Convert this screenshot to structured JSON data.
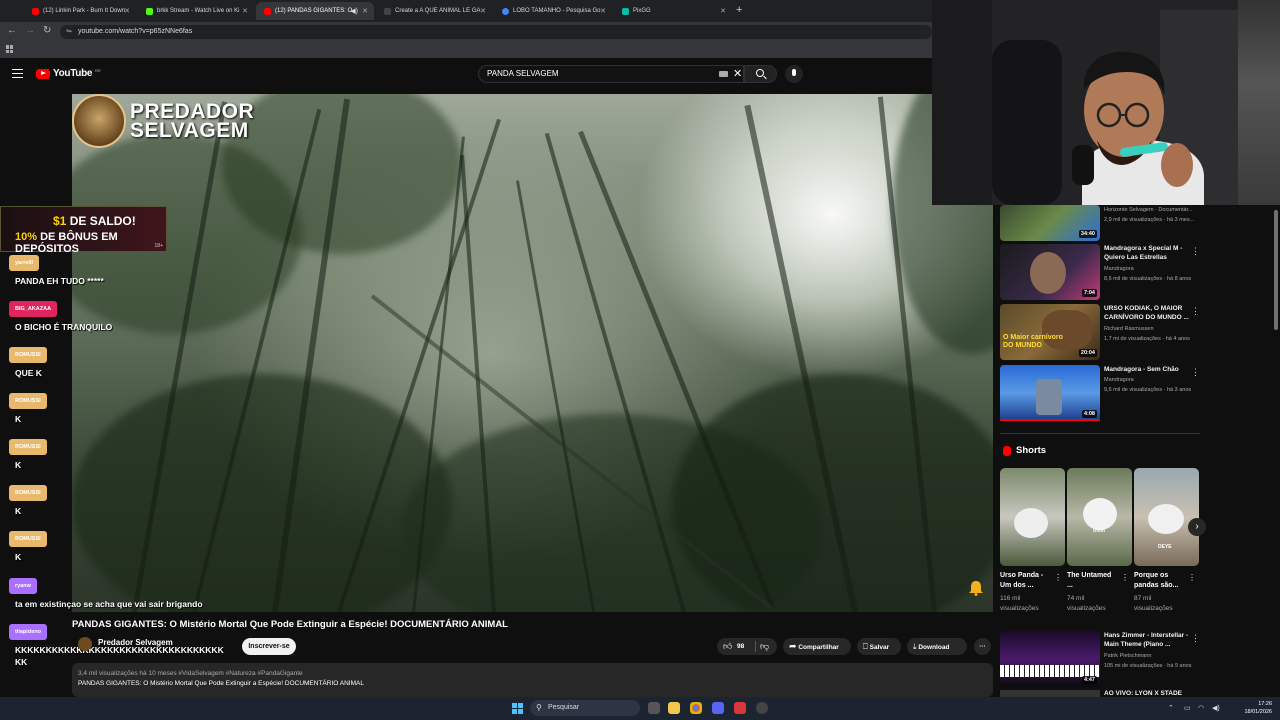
{
  "browser": {
    "tabs": [
      {
        "label": "(12) Linkin Park - Burn It Down",
        "color": "#ff0000"
      },
      {
        "label": "brkk Stream - Watch Live on Ki",
        "color": "#53fc18"
      },
      {
        "label": "(12) PANDAS GIGANTES: O",
        "color": "#ff0000",
        "active": true
      },
      {
        "label": "Create a A QUE ANIMAL LE GA",
        "color": "#444444"
      },
      {
        "label": "LOBO TAMANHO - Pesquisa Go",
        "color": "#4285f4"
      },
      {
        "label": "PixGG",
        "color": "#00bfa5"
      }
    ],
    "new_tab": "+",
    "url": "youtube.com/watch?v=p65zNNe6fas"
  },
  "youtube": {
    "logo_text": "YouTube",
    "logo_country": "BR",
    "search_value": "PANDA SELVAGEM"
  },
  "video": {
    "watermark_line1": "PREDADOR",
    "watermark_line2": "SELVAGEM",
    "title": "PANDAS GIGANTES: O Mistério Mortal Que Pode Extinguir a Espécie! DOCUMENTÁRIO ANIMAL",
    "channel": "Predador Selvagem",
    "subscribe": "Inscrever-se",
    "likes": "98",
    "share": "Compartilhar",
    "save": "Salvar",
    "download": "Download",
    "desc_meta": "3,4 mil visualizações  há 10 meses  #VidaSelvagem #Natureza #PandaGigante",
    "desc_text": "PANDAS GIGANTES: O Mistério Mortal Que Pode Extinguir a Espécie! DOCUMENTÁRIO ANIMAL"
  },
  "promo": {
    "amount": "$1",
    "line1_rest": " DE SALDO!",
    "percent": "10%",
    "line2_rest": " DE BÔNUS EM DEPÓSITOS",
    "age": "18+"
  },
  "chat": [
    {
      "user": "yarrelll",
      "color": "#e8b86d",
      "msg": "PANDA EH TUDO *****"
    },
    {
      "user": "BIG_AKAZAA",
      "color": "#e0245e",
      "msg": "O BICHO É TRANQUILO"
    },
    {
      "user": "ROMUSSI",
      "color": "#e8b86d",
      "msg": "QUE K"
    },
    {
      "user": "ROMUSSI",
      "color": "#e8b86d",
      "msg": "K"
    },
    {
      "user": "ROMUSSI",
      "color": "#e8b86d",
      "msg": "K"
    },
    {
      "user": "ROMUSSI",
      "color": "#e8b86d",
      "msg": "K"
    },
    {
      "user": "ROMUSSI",
      "color": "#e8b86d",
      "msg": "K"
    },
    {
      "user": "ryanw",
      "color": "#a970ff",
      "msg": "ta em existinçao se acha que vai sair brigando"
    },
    {
      "user": "tilapideno",
      "color": "#a970ff",
      "msg": "KKKKKKKKKKKKKKKKKKKKKKKKKKKKKKKKKK"
    },
    {
      "user": "",
      "color": "",
      "msg": "KK"
    }
  ],
  "sidebar": {
    "recs": [
      {
        "title": "",
        "channel": "Horizonte Selvagem · Documentár...",
        "meta": "2,9 mil de visualizações · há 3 mes...",
        "duration": "34:40"
      },
      {
        "title": "Mandragora x Special M - Quiero Las Estrellas",
        "channel": "Mandragora",
        "meta": "8,6 mil de visualizações · há 8 anos",
        "duration": "7:04"
      },
      {
        "title": "URSO KODIAK, O MAIOR CARNÍVORO DO MUNDO ...",
        "channel": "Richard Rasmussen",
        "meta": "1,7 mi de visualizações · há 4 anos",
        "duration": "20:04",
        "thumb_caption": "O Maior carnívoro DO MUNDO"
      },
      {
        "title": "Mandragora - Sem Chão",
        "channel": "Mandragora",
        "meta": "9,6 mil de visualizações · há 3 anos",
        "duration": "4:08"
      },
      {
        "title": "Hans Zimmer - Interstellar - Main Theme (Piano ...",
        "channel": "Patrik Pietschmann",
        "meta": "105 mi de visualizações · há 9 anos",
        "duration": "4:47"
      },
      {
        "title": "AO VIVO: LYON X STADE",
        "channel": "",
        "meta": "",
        "duration": ""
      }
    ],
    "shorts_label": "Shorts",
    "shorts": [
      {
        "title": "Urso Panda - Um dos ...",
        "views": "116 mil visualizações"
      },
      {
        "title": "The Untamed ...",
        "views": "74 mil visualizações",
        "thumb_caption": "them"
      },
      {
        "title": "Porque os pandas são...",
        "views": "87 mil visualizações",
        "thumb_caption": "DEYE"
      }
    ]
  },
  "taskbar": {
    "search_placeholder": "Pesquisar",
    "time": "17:26",
    "date": "18/01/2026"
  }
}
